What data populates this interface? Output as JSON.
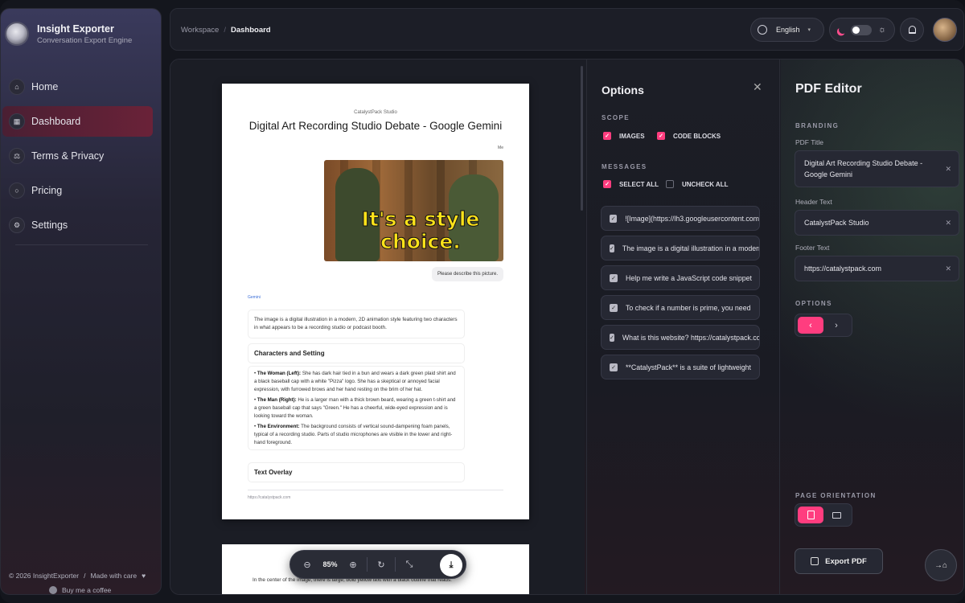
{
  "app": {
    "title": "Insight Exporter",
    "subtitle": "Conversation Export Engine"
  },
  "nav": [
    {
      "label": "Home",
      "icon": "home-icon",
      "glyph": "⌂"
    },
    {
      "label": "Dashboard",
      "icon": "grid-icon",
      "glyph": "▦"
    },
    {
      "label": "Terms & Privacy",
      "icon": "scale-icon",
      "glyph": "⚖"
    },
    {
      "label": "Pricing",
      "icon": "circle-icon",
      "glyph": "○"
    },
    {
      "label": "Settings",
      "icon": "gear-icon",
      "glyph": "⚙"
    }
  ],
  "footer": {
    "copyright": "© 2026 InsightExporter",
    "sep": "/",
    "made": "Made with care",
    "heart": "♥",
    "coffee": "Buy me a coffee"
  },
  "breadcrumb": {
    "root": "Workspace",
    "sep": "/",
    "current": "Dashboard"
  },
  "language": {
    "selected": "English"
  },
  "colors": {
    "accent": "#ff3d7f",
    "active_nav": "#6a2238"
  },
  "preview": {
    "header": "CatalystPack Studio",
    "title": "Digital Art Recording Studio Debate - Google Gemini",
    "me_label": "Me",
    "image_text": "It's a style choice.",
    "user_message": "Please describe this picture.",
    "gemini_label": "Gemini",
    "intro": "The image is a digital illustration in a modern, 2D animation style featuring two characters in what appears to be a recording studio or podcast booth.",
    "section1": "Characters and Setting",
    "bullets": [
      {
        "bold": "The Woman (Left):",
        "text": " She has dark hair tied in a bun and wears a dark green plaid shirt and a black baseball cap with a white \"Pizza\" logo. She has a skeptical or annoyed facial expression, with furrowed brows and her hand resting on the brim of her hat."
      },
      {
        "bold": "The Man (Right):",
        "text": " He is a larger man with a thick brown beard, wearing a green t-shirt and a green baseball cap that says \"Green.\" He has a cheerful, wide-eyed expression and is looking toward the woman."
      },
      {
        "bold": "The Environment:",
        "text": " The background consists of vertical sound-dampening foam panels, typical of a recording studio. Parts of studio microphones are visible in the lower and right-hand foreground."
      }
    ],
    "section2": "Text Overlay",
    "footer_url": "https://catalystpack.com",
    "page2_text": "In the center of the image, there is large, bold yellow text with a black outline that reads:"
  },
  "zoom": {
    "value": "85%"
  },
  "options": {
    "title": "Options",
    "scope_label": "SCOPE",
    "scope": [
      {
        "label": "IMAGES",
        "checked": true
      },
      {
        "label": "CODE BLOCKS",
        "checked": true
      }
    ],
    "messages_label": "MESSAGES",
    "select_all": "SELECT ALL",
    "uncheck_all": "UNCHECK ALL",
    "messages": [
      "![Image](https://lh3.googleusercontent.com",
      "The image is a digital illustration in a modern",
      "Help me write a JavaScript code snippet",
      "To check if a number is prime, you need",
      "What is this website? https://catalystpack.com",
      "**CatalystPack** is a suite of lightweight"
    ]
  },
  "editor": {
    "title": "PDF Editor",
    "branding_label": "BRANDING",
    "pdf_title_label": "PDF Title",
    "pdf_title_value": "Digital Art Recording Studio Debate - Google Gemini",
    "header_label": "Header Text",
    "header_value": "CatalystPack Studio",
    "footer_label": "Footer Text",
    "footer_value": "https://catalystpack.com",
    "options_label": "OPTIONS",
    "orientation_label": "PAGE ORIENTATION",
    "export_label": "Export PDF"
  }
}
